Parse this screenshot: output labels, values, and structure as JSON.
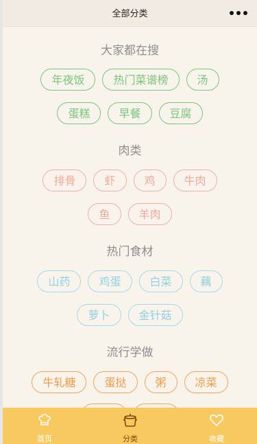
{
  "header": {
    "title": "全部分类"
  },
  "sections": [
    {
      "title": "大家都在搜",
      "color": "#79c47d",
      "rows": [
        [
          "年夜饭",
          "热门菜谱榜",
          "汤"
        ],
        [
          "蛋糕",
          "早餐",
          "豆腐"
        ]
      ]
    },
    {
      "title": "肉类",
      "color": "#f0a79a",
      "rows": [
        [
          "排骨",
          "虾",
          "鸡",
          "牛肉"
        ],
        [
          "鱼",
          "羊肉"
        ]
      ]
    },
    {
      "title": "热门食材",
      "color": "#93d0e3",
      "rows": [
        [
          "山药",
          "鸡蛋",
          "白菜",
          "藕"
        ],
        [
          "萝卜",
          "金针菇"
        ]
      ]
    },
    {
      "title": "流行学做",
      "color": "#f09a46",
      "rows": [
        [
          "牛轧糖",
          "蛋挞",
          "粥",
          "凉菜"
        ]
      ]
    }
  ],
  "tabbar": {
    "items": [
      {
        "label": "首页",
        "icon": "chef-hat-icon"
      },
      {
        "label": "分类",
        "icon": "pot-icon"
      },
      {
        "label": "收藏",
        "icon": "heart-icon"
      }
    ],
    "active": "分类",
    "background": "#f7c95e"
  }
}
